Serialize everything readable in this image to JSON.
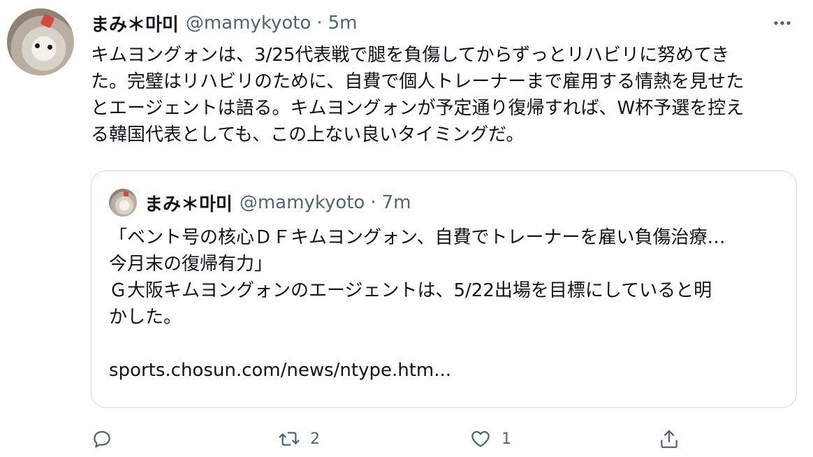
{
  "tweet": {
    "author_name": "まみ＊마미",
    "handle": "@mamykyoto",
    "separator": "·",
    "time": "5m",
    "more_icon": "more-horizontal-icon",
    "text_lines": [
      "キムヨングォンは、3/25代表戦で腿を負傷してからずっとリハビリに努めてき",
      "た。完璧はリハビリのために、自費で個人トレーナーまで雇用する情熱を見せた",
      "とエージェントは語る。キムヨングォンが予定通り復帰すれば、W杯予選を控え",
      "る韓国代表としても、この上ない良いタイミングだ。"
    ]
  },
  "quote": {
    "author_name": "まみ＊마미",
    "handle": "@mamykyoto",
    "separator": "·",
    "time": "7m",
    "text_lines": [
      "「ベント号の核心ＤＦキムヨングォン、自費でトレーナーを雇い負傷治療…",
      "今月末の復帰有力」",
      "Ｇ大阪キムヨングォンのエージェントは、5/22出場を目標にしていると明",
      "かした。"
    ],
    "link": "sports.chosun.com/news/ntype.htm..."
  },
  "actions": {
    "reply": {
      "icon": "reply-icon",
      "count": ""
    },
    "retweet": {
      "icon": "retweet-icon",
      "count": "2"
    },
    "like": {
      "icon": "like-icon",
      "count": "1"
    },
    "share": {
      "icon": "share-icon",
      "count": ""
    }
  },
  "colors": {
    "text": "#0f1419",
    "secondary": "#536471",
    "border": "#cfd9de"
  }
}
